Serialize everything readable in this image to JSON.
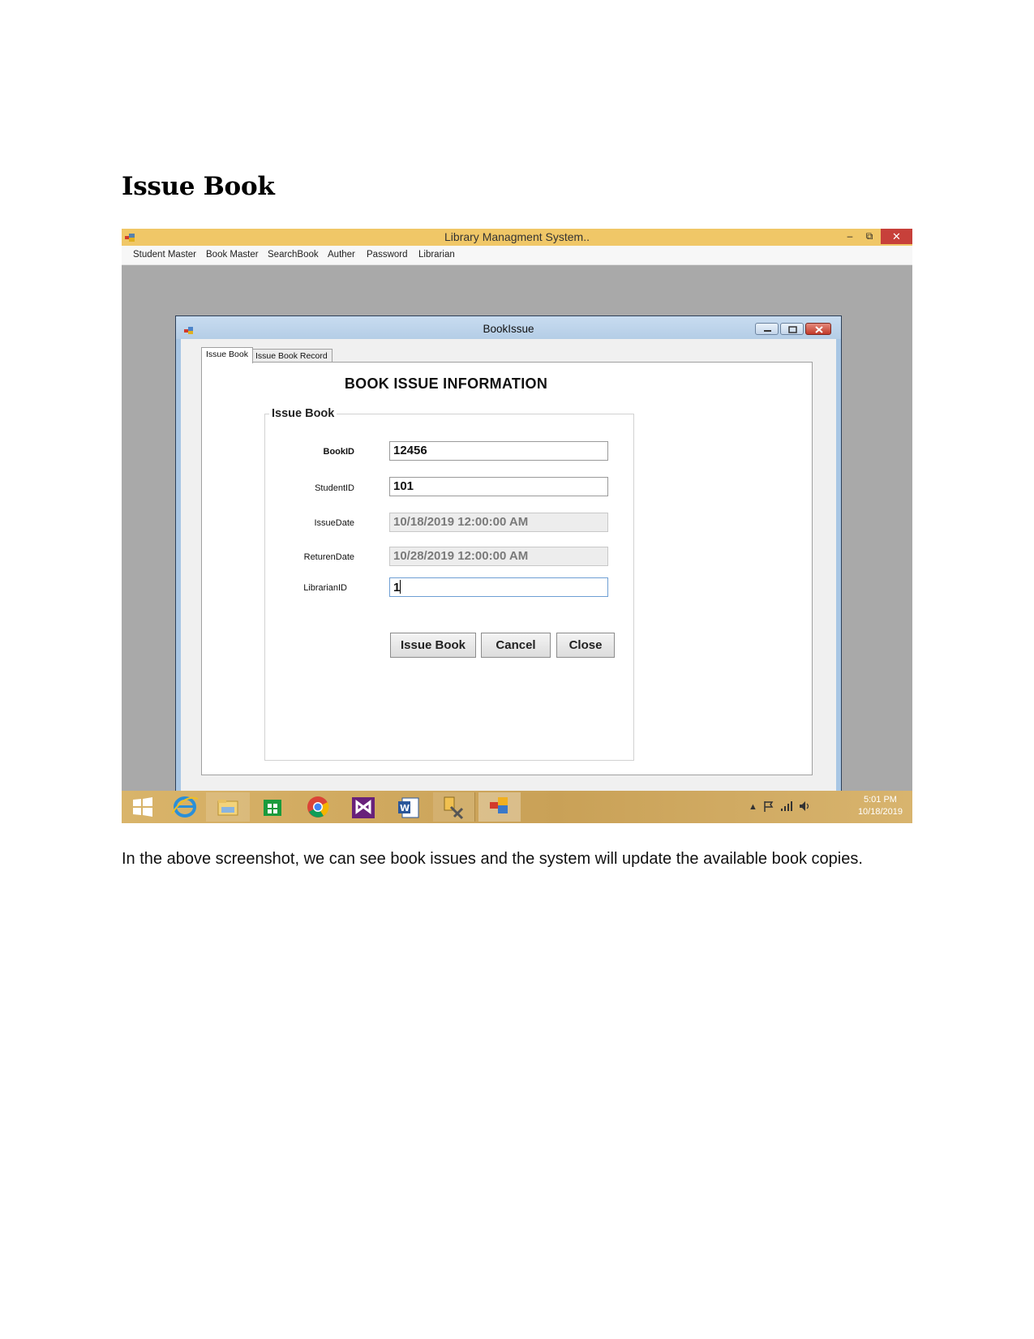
{
  "document": {
    "heading": "Issue Book",
    "caption": "In the above screenshot, we can see book issues and the system will update the available book copies."
  },
  "main_window": {
    "title": "Library Managment System..",
    "controls": {
      "minimize": "–",
      "restore": "⧉",
      "close": "✕"
    },
    "menu": [
      "Student Master",
      "Book Master",
      "SearchBook",
      "Auther",
      "Password",
      "Librarian"
    ]
  },
  "child_window": {
    "title": "BookIssue",
    "tabs": [
      "Issue Book",
      "Issue Book Record"
    ],
    "form_title": "BOOK ISSUE INFORMATION",
    "group_title": "Issue Book",
    "fields": [
      {
        "label": "BookID",
        "value": "12456"
      },
      {
        "label": "StudentID",
        "value": "101"
      },
      {
        "label": "IssueDate",
        "value": "10/18/2019 12:00:00 AM"
      },
      {
        "label": "ReturenDate",
        "value": "10/28/2019 12:00:00 AM"
      },
      {
        "label": "LibrarianID",
        "value": "1"
      }
    ],
    "buttons": {
      "issue": "Issue Book",
      "cancel": "Cancel",
      "close": "Close"
    }
  },
  "taskbar": {
    "apps": [
      "windows-start-icon",
      "internet-explorer-icon",
      "file-explorer-icon",
      "store-icon",
      "chrome-icon",
      "visual-studio-icon",
      "word-icon",
      "tools-icon",
      "app-icon"
    ],
    "tray_arrow": "▲",
    "time": "5:01 PM",
    "date": "10/18/2019"
  },
  "colors": {
    "main_titlebar": "#f0c767",
    "taskbar": "#c9a157",
    "close_button": "#c7403a",
    "mdi_background": "#a9a9a9"
  }
}
